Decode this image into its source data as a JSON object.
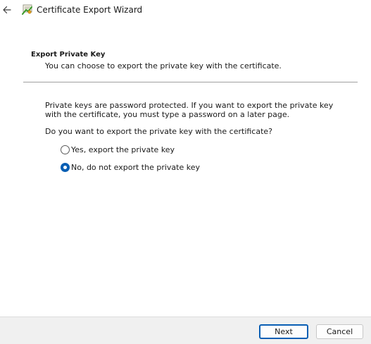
{
  "window": {
    "title": "Certificate Export Wizard"
  },
  "header": {
    "title": "Export Private Key",
    "description": "You can choose to export the private key with the certificate."
  },
  "body": {
    "info": "Private keys are password protected. If you want to export the private key with the certificate, you must type a password on a later page.",
    "question": "Do you want to export the private key with the certificate?",
    "options": [
      {
        "label": "Yes, export the private key",
        "selected": false
      },
      {
        "label": "No, do not export the private key",
        "selected": true
      }
    ]
  },
  "footer": {
    "next_label": "Next",
    "cancel_label": "Cancel"
  },
  "colors": {
    "accent": "#0a5fb4",
    "footer_bg": "#f0f0f0",
    "divider": "#a0a0a0"
  },
  "icons": {
    "back": "back-arrow-icon",
    "app": "certificate-icon"
  }
}
